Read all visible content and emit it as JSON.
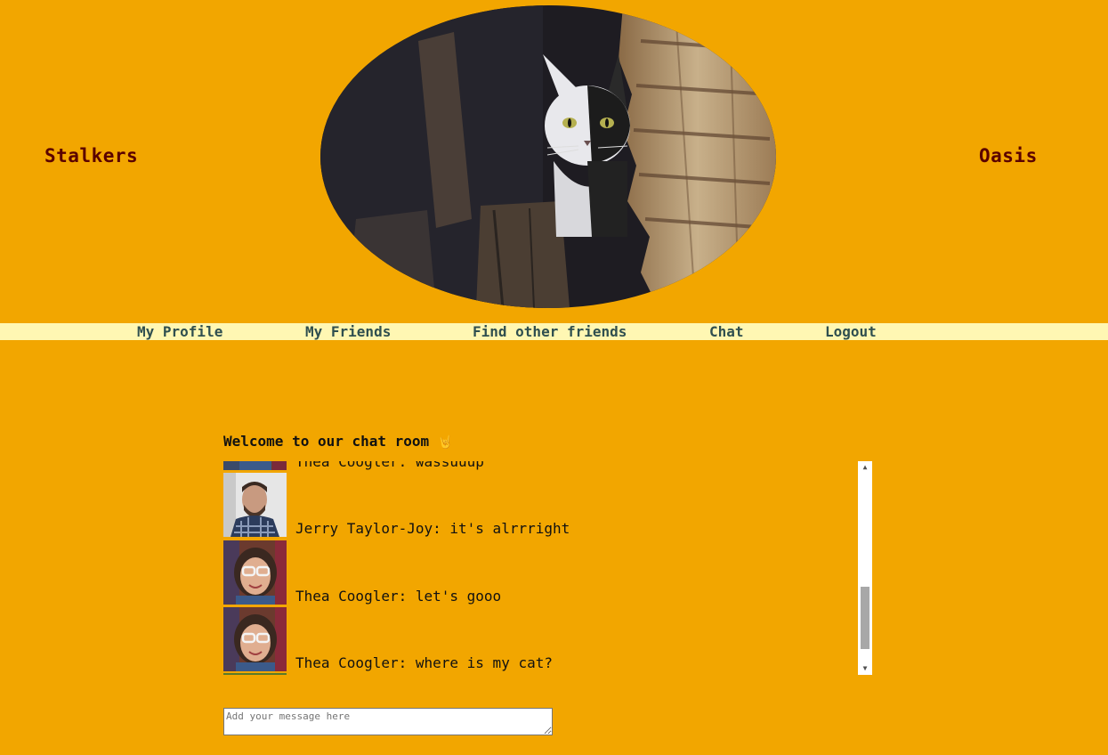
{
  "brand": {
    "left": "Stalkers",
    "right": "Oasis"
  },
  "hero": {
    "image": "cat-peeking-photo"
  },
  "nav": [
    {
      "label": "My Profile"
    },
    {
      "label": "My Friends"
    },
    {
      "label": "Find other friends"
    },
    {
      "label": "Chat"
    },
    {
      "label": "Logout"
    }
  ],
  "chat": {
    "title": "Welcome to our chat room",
    "title_emoji": "🤘",
    "messages": [
      {
        "author": "Thea Coogler",
        "text": "Thea Coogler: wassuuup"
      },
      {
        "author": "Jerry Taylor-Joy",
        "text": "Jerry Taylor-Joy: it's alrrright"
      },
      {
        "author": "Thea Coogler",
        "text": "Thea Coogler: let's gooo"
      },
      {
        "author": "Thea Coogler",
        "text": "Thea Coogler: where is my cat?"
      }
    ],
    "input_placeholder": "Add your message here"
  },
  "colors": {
    "background": "#f2a600",
    "nav_bar": "#fff7b3",
    "brand_text": "#5a0000",
    "nav_text": "#2f4f4f"
  }
}
